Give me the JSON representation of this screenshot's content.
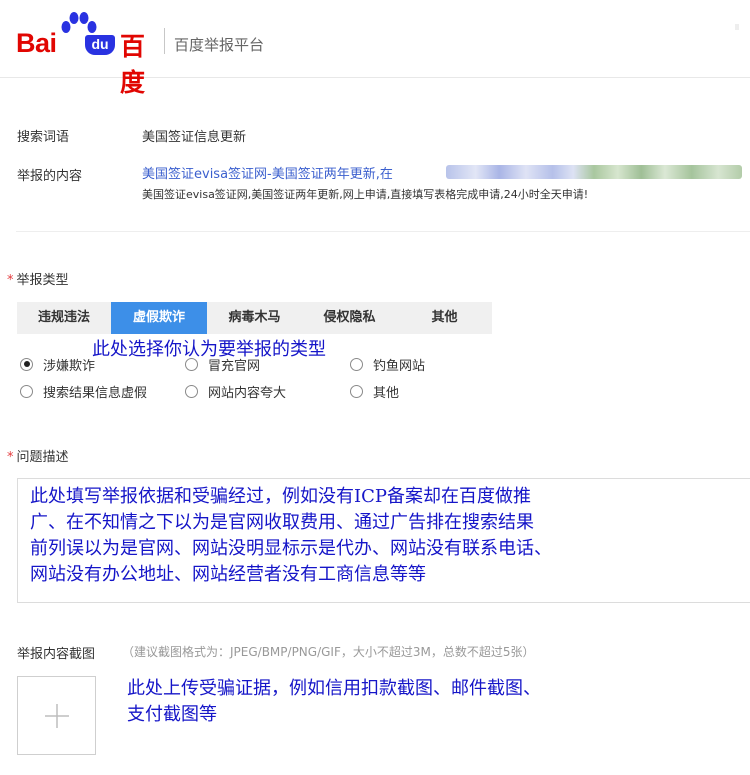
{
  "header": {
    "logo_bai": "Bai",
    "logo_du": "du",
    "logo_zh": "百度",
    "platform_title": "百度举报平台"
  },
  "form": {
    "search_term_label": "搜索词语",
    "search_term_value": "美国签证信息更新",
    "report_content_label": "举报的内容",
    "report_content_title": "美国签证evisa签证网-美国签证两年更新,在",
    "report_content_desc": "美国签证evisa签证网,美国签证两年更新,网上申请,直接填写表格完成申请,24小时全天申请!",
    "report_type_label": "举报类型",
    "tabs": [
      {
        "label": "违规违法"
      },
      {
        "label": "虚假欺诈"
      },
      {
        "label": "病毒木马"
      },
      {
        "label": "侵权隐私"
      },
      {
        "label": "其他"
      }
    ],
    "active_tab_index": 1,
    "radio_options": [
      {
        "label": "涉嫌欺诈",
        "checked": true
      },
      {
        "label": "冒充官网",
        "checked": false
      },
      {
        "label": "钓鱼网站",
        "checked": false
      },
      {
        "label": "搜索结果信息虚假",
        "checked": false
      },
      {
        "label": "网站内容夸大",
        "checked": false
      },
      {
        "label": "其他",
        "checked": false
      }
    ],
    "description_label": "问题描述",
    "screenshot_label": "举报内容截图",
    "screenshot_hint": "（建议截图格式为：JPEG/BMP/PNG/GIF，大小不超过3M，总数不超过5张）",
    "upload_icon": "plus-icon"
  },
  "annotations": {
    "type_hint": "此处选择你认为要举报的类型",
    "description_hint": [
      "此处填写举报依据和受骗经过，例如没有ICP备案却在百度做推",
      "广、在不知情之下以为是官网收取费用、通过广告排在搜索结果",
      "前列误以为是官网、网站没明显标示是代办、网站没有联系电话、",
      "网站没有办公地址、网站经营者没有工商信息等等"
    ],
    "upload_hint": [
      "此处上传受骗证据，例如信用扣款截图、邮件截图、",
      "支付截图等"
    ]
  },
  "colors": {
    "brand_red": "#e10602",
    "brand_blue": "#2932e1",
    "tab_active": "#3d8fe8",
    "link_blue": "#3b5fce",
    "annotation_blue": "#1515c8"
  }
}
